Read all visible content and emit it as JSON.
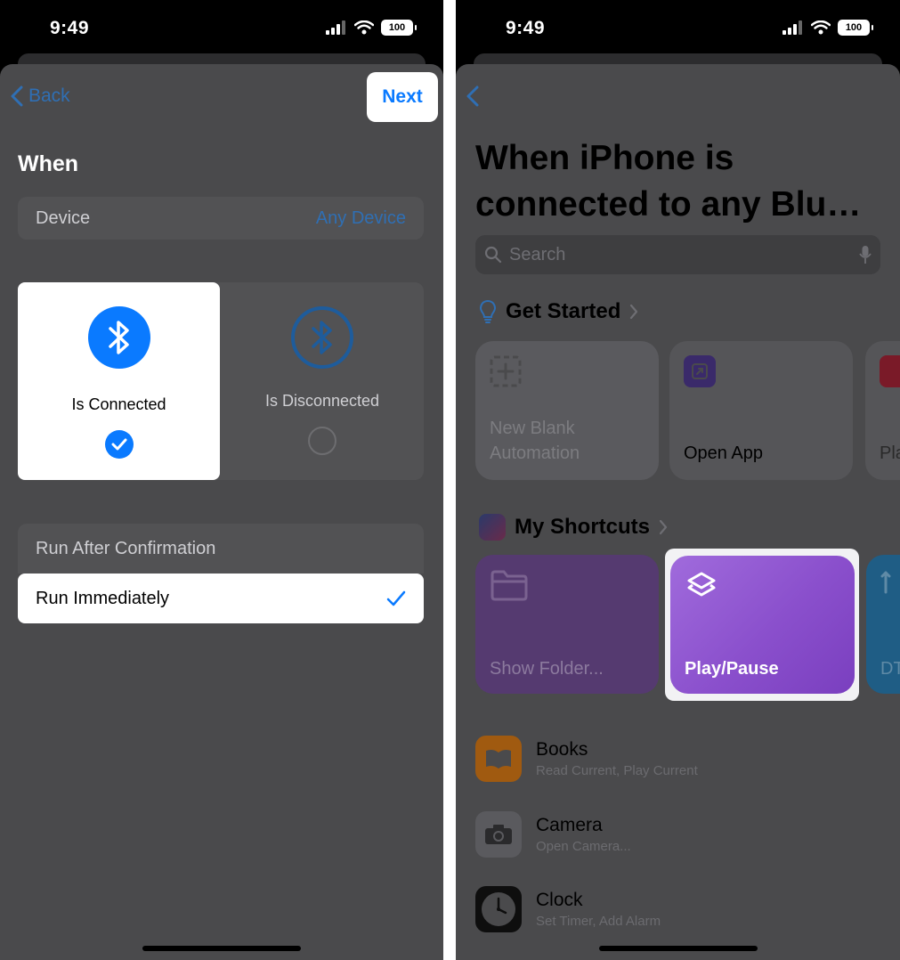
{
  "status_bar": {
    "time": "9:49",
    "battery": "100"
  },
  "left_screen": {
    "nav": {
      "back_label": "Back",
      "next_label": "Next"
    },
    "section_title": "When",
    "device_row": {
      "label": "Device",
      "value": "Any Device"
    },
    "states": [
      {
        "label": "Is Connected",
        "selected": true
      },
      {
        "label": "Is Disconnected",
        "selected": false
      }
    ],
    "run_options": [
      {
        "label": "Run After Confirmation",
        "selected": false
      },
      {
        "label": "Run Immediately",
        "selected": true
      }
    ]
  },
  "right_screen": {
    "title": "When iPhone is connected to any Blu…",
    "search_placeholder": "Search",
    "get_started": {
      "heading": "Get Started",
      "cards": [
        {
          "label_line1": "New Blank",
          "label_line2": "Automation",
          "icon": "plus-square-dashed-icon"
        },
        {
          "label": "Open App",
          "icon": "app-arrow-icon"
        },
        {
          "label": "Pla",
          "icon": "music-icon"
        }
      ]
    },
    "my_shortcuts": {
      "heading": "My Shortcuts",
      "cards": [
        {
          "label": "Show Folder...",
          "icon": "folder-icon"
        },
        {
          "label": "Play/Pause",
          "icon": "shortcuts-layers-icon"
        },
        {
          "label": "DT",
          "icon": "arrows-icon"
        }
      ]
    },
    "apps": [
      {
        "name": "Books",
        "subtitle": "Read Current, Play Current",
        "icon": "books-icon"
      },
      {
        "name": "Camera",
        "subtitle": "Open Camera...",
        "icon": "camera-icon"
      },
      {
        "name": "Clock",
        "subtitle": "Set Timer, Add Alarm",
        "icon": "clock-icon"
      }
    ]
  },
  "colors": {
    "accent": "#0a7aff",
    "dim_accent": "#2f6fb4",
    "sheet_dim": "#4a4a4c",
    "shortcut_purple": "#8a4fcc"
  }
}
